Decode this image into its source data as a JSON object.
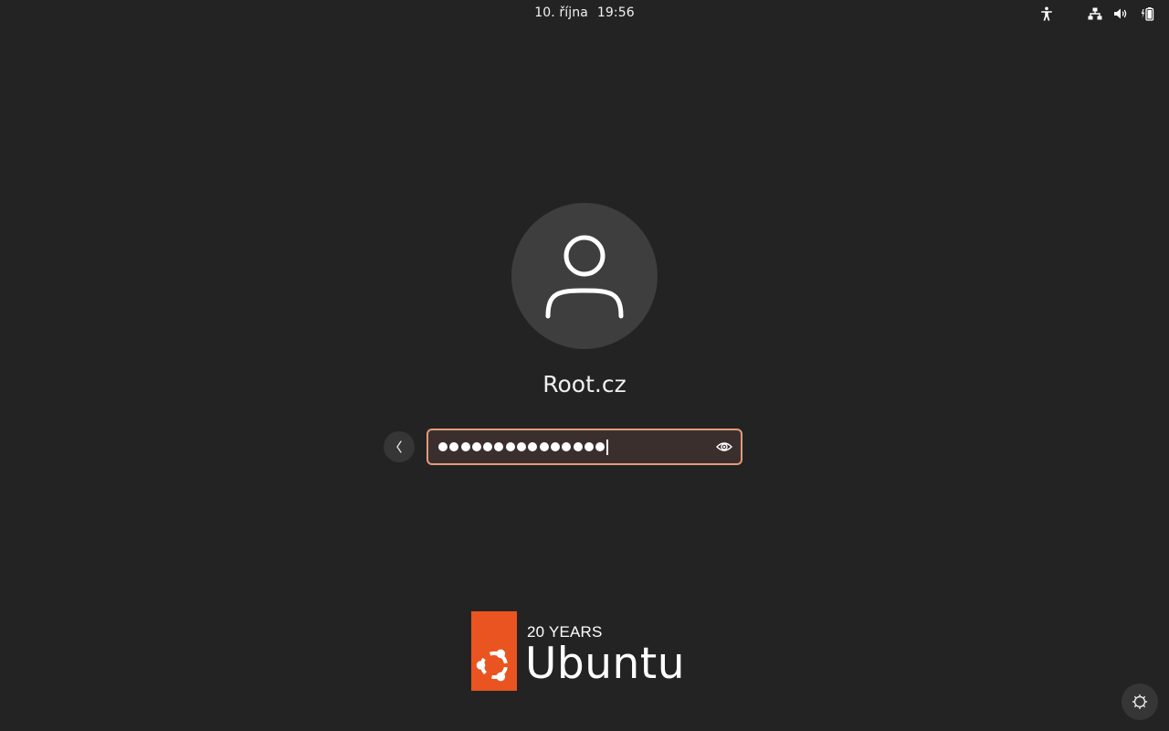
{
  "topbar": {
    "date": "10. října",
    "time": "19:56",
    "icons": [
      "accessibility-icon",
      "network-icon",
      "volume-icon",
      "battery-icon"
    ]
  },
  "login": {
    "username": "Root.cz",
    "avatar_icon": "user-icon",
    "password_length": 15,
    "password_field_state": "focused",
    "back_icon": "chevron-left-icon",
    "reveal_icon": "eye-icon"
  },
  "branding": {
    "subtitle": "20 YEARS",
    "name": "Ubuntu",
    "accent_color": "#E95420"
  },
  "session": {
    "settings_icon": "gear-icon"
  },
  "colors": {
    "background": "#232323",
    "field_border": "#E39A7C",
    "field_bg": "#3B2F2D",
    "avatar_bg": "#3E3E3E"
  }
}
